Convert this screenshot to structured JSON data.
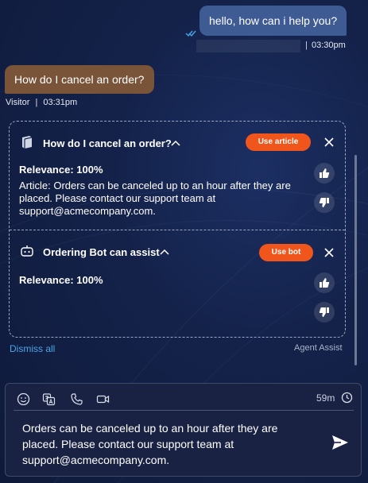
{
  "conversation": {
    "agent_message": "hello, how can i help you?",
    "agent_time": "03:30pm",
    "visitor_message": "How do I cancel an order?",
    "visitor_name": "Visitor",
    "visitor_time": "03:31pm",
    "separator": "|"
  },
  "assist": {
    "article_card": {
      "title": "How do I cancel an order?",
      "button": "Use article",
      "relevance": "Relevance: 100%",
      "text": "Article: Orders can be canceled up to an hour after they are placed. Please contact our support team at support@acmecompany.com."
    },
    "bot_card": {
      "title": "Ordering Bot can assist",
      "button": "Use bot",
      "relevance": "Relevance: 100%"
    },
    "dismiss_all": "Dismiss all",
    "label": "Agent Assist"
  },
  "composer": {
    "timer": "59m",
    "text": "Orders can be canceled up to an hour after they are placed. Please contact our support team at support@acmecompany.com.",
    "icons": [
      "emoji-icon",
      "translate-icon",
      "phone-icon",
      "video-icon",
      "clock-icon",
      "send-icon"
    ]
  },
  "colors": {
    "agent_bubble": "#3f5b93",
    "visitor_bubble": "#7a5438",
    "accent_button": "#f0551c",
    "link": "#4aa5e6"
  }
}
